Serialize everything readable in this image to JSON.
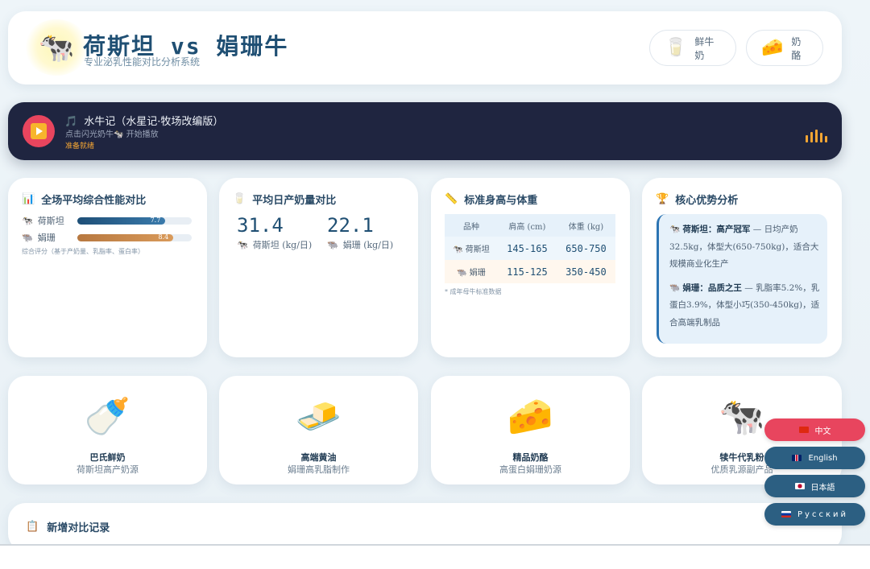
{
  "header": {
    "logo_icon": "cow-icon",
    "title": "荷斯坦 vs 娟珊牛",
    "subtitle": "专业泌乳性能对比分析系统",
    "buttons": [
      {
        "icon": "milk-glass-icon",
        "label": "鲜牛奶"
      },
      {
        "icon": "cheese-icon",
        "label": "奶酪"
      }
    ]
  },
  "player": {
    "title": "水牛记（水星记·牧场改编版）",
    "hint": "点击闪光奶牛🐄 开始播放",
    "status": "准备就绪",
    "eq_levels": [
      0.55,
      0.8,
      1.0,
      0.75,
      0.5
    ]
  },
  "score_card": {
    "title": "全场平均综合性能对比",
    "rows": [
      {
        "label": "荷斯坦",
        "value": "7.7",
        "fraction": 0.77
      },
      {
        "label": "娟珊",
        "value": "8.4",
        "fraction": 0.84
      }
    ],
    "note": "综合评分（基于产奶量、乳脂率、蛋白率）"
  },
  "milk_card": {
    "title": "平均日产奶量对比",
    "holstein": {
      "value": "31.4",
      "label": "荷斯坦 (kg/日)"
    },
    "jersey": {
      "value": "22.1",
      "label": "娟珊 (kg/日)"
    }
  },
  "size_card": {
    "title": "标准身高与体重",
    "headers": [
      "品种",
      "肩高 (cm)",
      "体重 (kg)"
    ],
    "rows": [
      {
        "breed": "荷斯坦",
        "height": "145-165",
        "weight": "650-750"
      },
      {
        "breed": "娟珊",
        "height": "115-125",
        "weight": "350-450"
      }
    ],
    "note": "* 成年母牛标准数据"
  },
  "advantage_card": {
    "title": "核心优势分析",
    "items": [
      {
        "name": "荷斯坦：高产冠军",
        "text": " — 日均产奶32.5kg，体型大(650-750kg)，适合大规模商业化生产"
      },
      {
        "name": "娟珊：品质之王",
        "text": " — 乳脂率5.2%，乳蛋白3.9%，体型小巧(350-450kg)，适合高端乳制品"
      }
    ]
  },
  "products": [
    {
      "icon": "baby-bottle-icon",
      "name": "巴氏鲜奶",
      "desc": "荷斯坦高产奶源"
    },
    {
      "icon": "butter-icon",
      "name": "高端黄油",
      "desc": "娟珊高乳脂制作"
    },
    {
      "icon": "cheese-icon",
      "name": "精品奶酪",
      "desc": "高蛋白娟珊奶源"
    },
    {
      "icon": "cow-icon",
      "name": "犊牛代乳粉",
      "desc": "优质乳源副产品"
    }
  ],
  "records": {
    "title": "新增对比记录"
  },
  "languages": [
    {
      "label": "中文",
      "active": true
    },
    {
      "label": "English",
      "active": false
    },
    {
      "label": "日本語",
      "active": false
    },
    {
      "label": "Русский",
      "active": false
    }
  ],
  "colors": {
    "accent": "#e8455e",
    "primary": "#1f4f73",
    "player_bg": "#1f2540",
    "amber": "#f3a533"
  }
}
